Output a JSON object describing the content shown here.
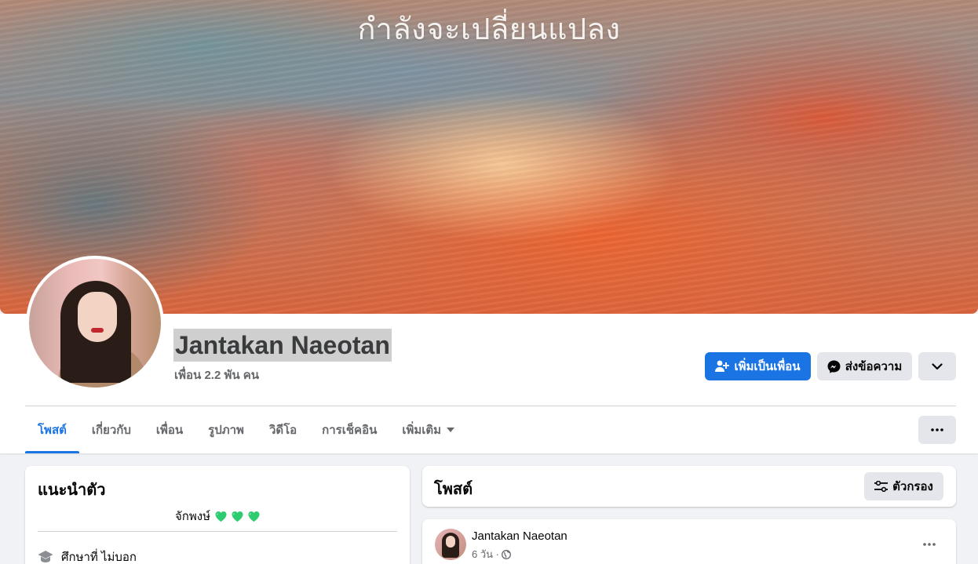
{
  "cover": {
    "overlay_text": "กำลังจะเปลี่ยนแปลง"
  },
  "profile": {
    "name": "Jantakan Naeotan",
    "friends_count": "เพื่อน 2.2 พัน คน"
  },
  "actions": {
    "add_friend_label": "เพิ่มเป็นเพื่อน",
    "message_label": "ส่งข้อความ"
  },
  "tabs": [
    {
      "label": "โพสต์",
      "active": true
    },
    {
      "label": "เกี่ยวกับ"
    },
    {
      "label": "เพื่อน"
    },
    {
      "label": "รูปภาพ"
    },
    {
      "label": "วิดีโอ"
    },
    {
      "label": "การเช็คอิน"
    },
    {
      "label": "เพิ่มเติม"
    }
  ],
  "intro": {
    "title": "แนะนำตัว",
    "bio": "จักพงษ์",
    "education": "ศึกษาที่ ไม่บอก"
  },
  "posts": {
    "title": "โพสต์",
    "filter_label": "ตัวกรอง"
  },
  "post": {
    "author": "Jantakan Naeotan",
    "time": "6 วัน ·"
  },
  "colors": {
    "accent": "#1b74e4",
    "heart": "#2ecc71"
  }
}
